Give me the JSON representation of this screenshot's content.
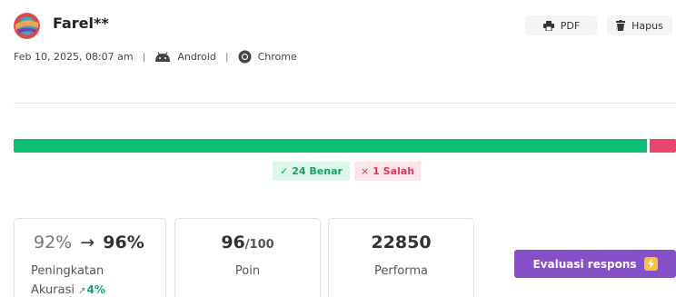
{
  "header": {
    "name": "Farel**",
    "date": "Feb 10, 2025, 08:07 am",
    "separator": "|",
    "os": "Android",
    "browser": "Chrome",
    "avatar_icon": "planet-avatar-icon"
  },
  "actions": {
    "pdf_label": "PDF",
    "delete_label": "Hapus"
  },
  "result": {
    "correct_fraction": 0.96,
    "correct_label": "24 Benar",
    "wrong_label": "1 Salah",
    "correct_mark": "✓",
    "wrong_mark": "×",
    "correct_color": "#0fbf73",
    "wrong_color": "#e8466b"
  },
  "stats": {
    "accuracy": {
      "from": "92%",
      "arrow": "→",
      "to": "96%",
      "label": "Peningkatan",
      "label2": "Akurasi",
      "delta_icon": "↗",
      "delta": "4%"
    },
    "points": {
      "value": "96",
      "denominator": "/100",
      "label": "Poin"
    },
    "performance": {
      "value": "22850",
      "label": "Performa"
    }
  },
  "evaluate": {
    "label": "Evaluasi respons",
    "icon": "lightning-icon",
    "color": "#8650c8"
  }
}
